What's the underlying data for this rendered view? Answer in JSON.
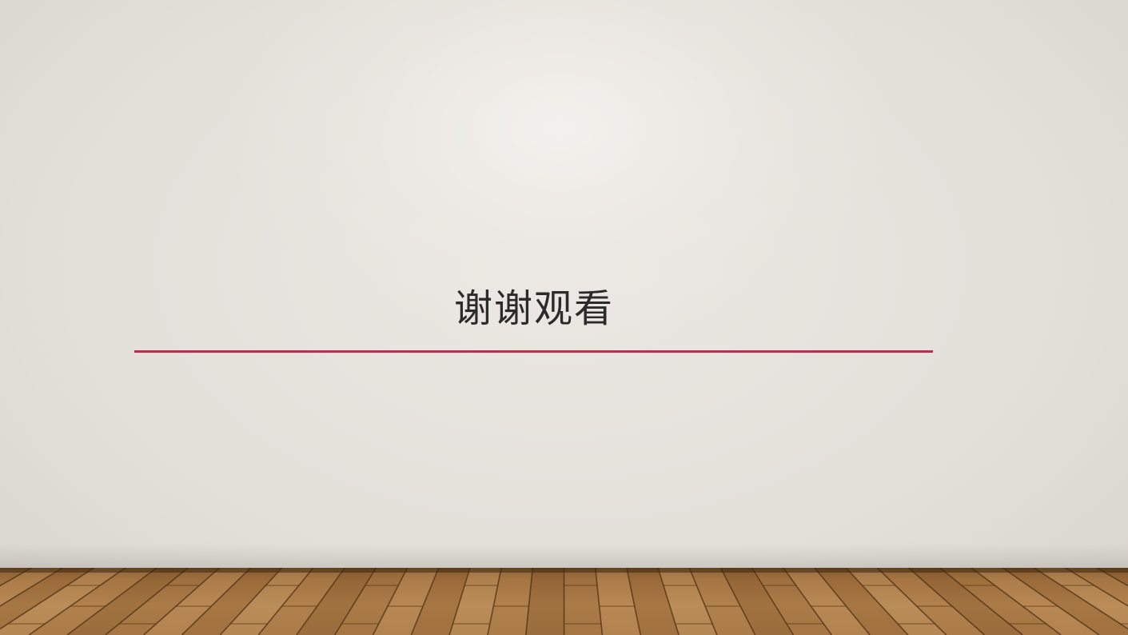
{
  "slide": {
    "title": "谢谢观看",
    "accent_color": "#c8284e",
    "background": "light-gray-wall-with-wooden-floor"
  }
}
